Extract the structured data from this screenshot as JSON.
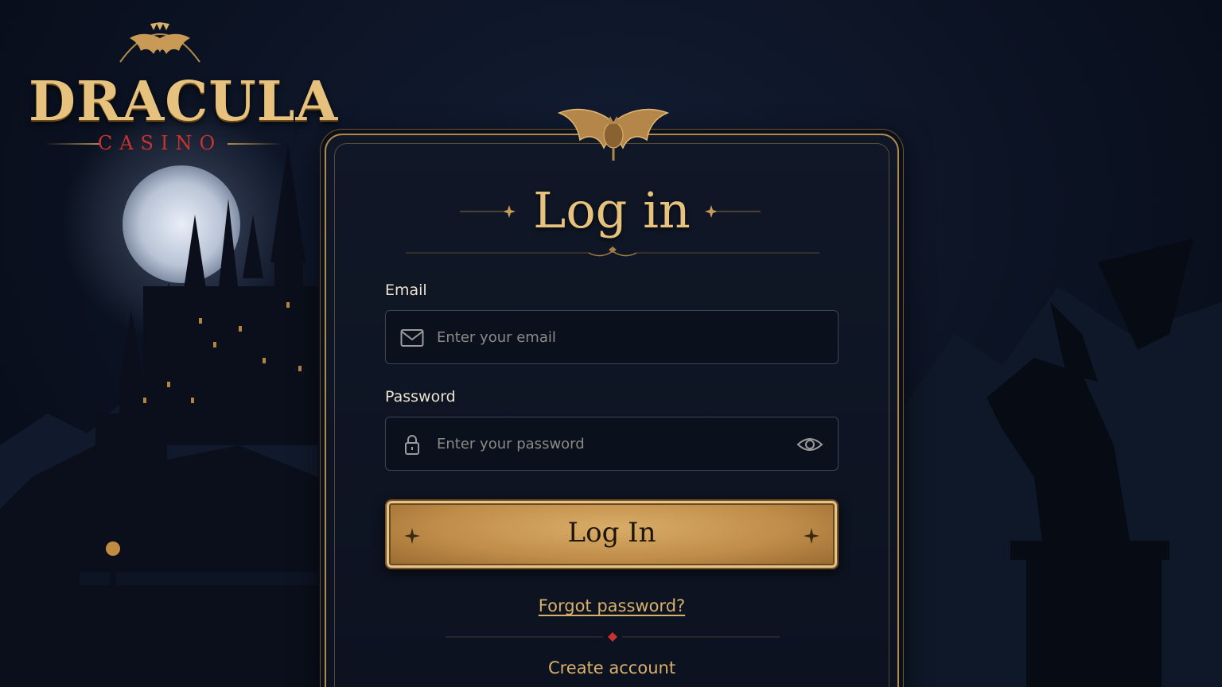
{
  "brand": {
    "name": "DRACULA",
    "subtitle": "CASINO"
  },
  "login": {
    "title": "Log in",
    "email_label": "Email",
    "email_placeholder": "Enter your email",
    "password_label": "Password",
    "password_placeholder": "Enter your password",
    "submit_label": "Log In",
    "forgot_label": "Forgot password?",
    "create_label": "Create account"
  },
  "icons": {
    "email": "mail-icon",
    "password": "lock-icon",
    "toggle": "eye-icon",
    "crest": "bat-icon"
  },
  "colors": {
    "gold": "#e6c27e",
    "accent_red": "#c7332f",
    "background": "#0b1222"
  }
}
